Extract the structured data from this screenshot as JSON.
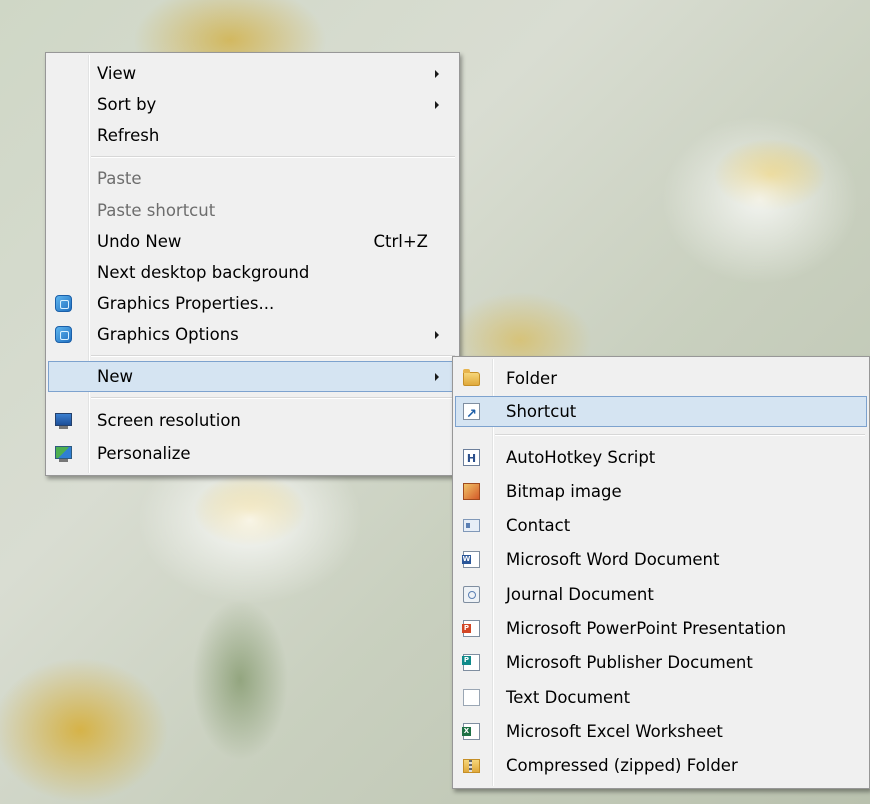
{
  "context_menu": {
    "items": [
      {
        "label": "View",
        "submenu": true
      },
      {
        "label": "Sort by",
        "submenu": true
      },
      {
        "label": "Refresh"
      },
      {
        "label": "Paste",
        "disabled": true
      },
      {
        "label": "Paste shortcut",
        "disabled": true
      },
      {
        "label": "Undo New",
        "shortcut": "Ctrl+Z"
      },
      {
        "label": "Next desktop background"
      },
      {
        "label": "Graphics Properties...",
        "icon": "graphics-icon"
      },
      {
        "label": "Graphics Options",
        "icon": "graphics-icon",
        "submenu": true
      },
      {
        "label": "New",
        "submenu": true,
        "selected": true
      },
      {
        "label": "Screen resolution",
        "icon": "screen-resolution-icon"
      },
      {
        "label": "Personalize",
        "icon": "personalize-icon"
      }
    ]
  },
  "new_submenu": {
    "items": [
      {
        "label": "Folder",
        "icon": "folder-icon"
      },
      {
        "label": "Shortcut",
        "icon": "shortcut-icon",
        "selected": true
      },
      {
        "label": "AutoHotkey Script",
        "icon": "autohotkey-script-icon"
      },
      {
        "label": "Bitmap image",
        "icon": "bitmap-image-icon"
      },
      {
        "label": "Contact",
        "icon": "contact-icon"
      },
      {
        "label": "Microsoft Word Document",
        "icon": "word-document-icon"
      },
      {
        "label": "Journal Document",
        "icon": "journal-document-icon"
      },
      {
        "label": "Microsoft PowerPoint Presentation",
        "icon": "powerpoint-presentation-icon"
      },
      {
        "label": "Microsoft Publisher Document",
        "icon": "publisher-document-icon"
      },
      {
        "label": "Text Document",
        "icon": "text-document-icon"
      },
      {
        "label": "Microsoft Excel Worksheet",
        "icon": "excel-worksheet-icon"
      },
      {
        "label": "Compressed (zipped) Folder",
        "icon": "zip-folder-icon"
      }
    ]
  },
  "colors": {
    "menu_background": "#f0f0f0",
    "menu_border": "#979797",
    "selected_background": "#d5e4f2",
    "selected_border": "#7da2ce",
    "disabled_text": "#6d6d6d"
  }
}
